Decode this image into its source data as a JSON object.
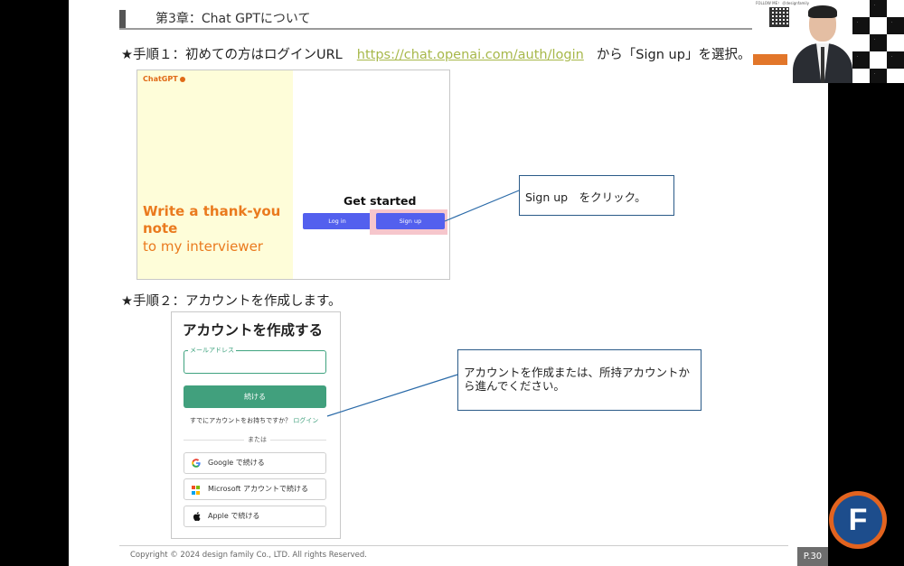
{
  "slide": {
    "chapter_title": "第3章：Chat GPTについて",
    "step1": {
      "prefix": "★手順１：初めての方はログインURL",
      "url": "https://chat.openai.com/auth/login",
      "suffix": "から「Sign up」を選択。"
    },
    "step2": "★手順２：アカウントを作成します。",
    "screenshot1": {
      "brand": "ChatGPT",
      "hero_bold": "Write a thank-you note",
      "hero_regular": "to my interviewer",
      "get_started": "Get started",
      "login_button": "Log in",
      "signup_button": "Sign up"
    },
    "callout1": "Sign up　をクリック。",
    "screenshot2": {
      "title": "アカウントを作成する",
      "email_label": "メールアドレス",
      "continue_button": "続ける",
      "have_account": "すでにアカウントをお持ちですか？",
      "login_link": "ログイン",
      "or": "または",
      "google": "Google で続ける",
      "microsoft": "Microsoft アカウントで続ける",
      "apple": "Apple で続ける"
    },
    "callout2": "アカウントを作成または、所持アカウントから進んでください。",
    "copyright": "Copyright © 2024 design family Co., LTD. All rights Reserved.",
    "page_number": "P.30"
  },
  "webcam": {
    "top_text": "FOLLOW ME！ ＠designfamily"
  },
  "logo": {
    "letter": "F"
  },
  "colors": {
    "accent_orange": "#e06a17",
    "link_green": "#a7b84a",
    "button_blue": "#5360ee",
    "button_green": "#41a07d",
    "callout_border": "#2a5a88"
  }
}
